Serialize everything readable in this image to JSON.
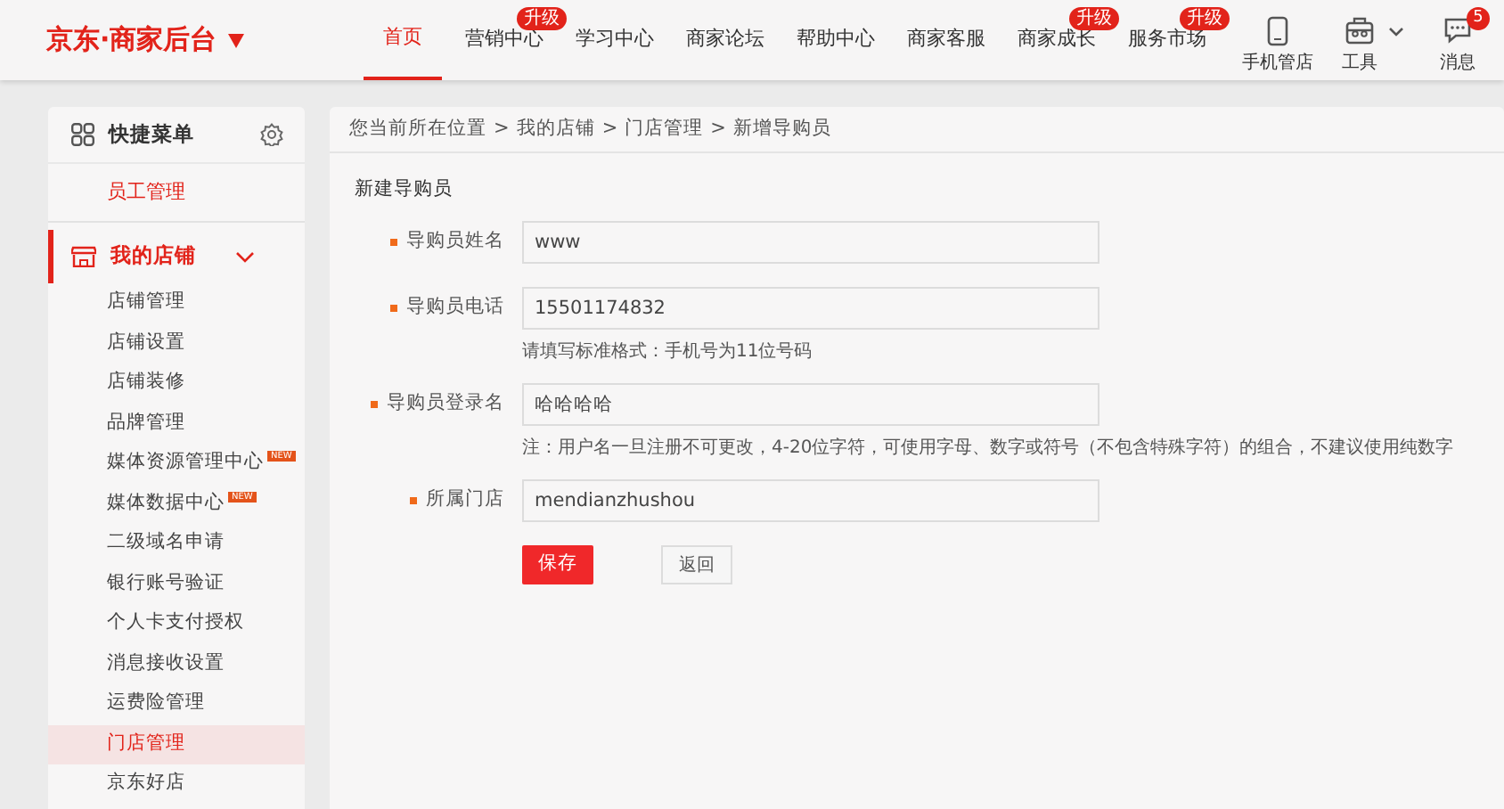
{
  "header": {
    "logo": "京东·商家后台",
    "nav": [
      {
        "label": "首页",
        "selected": true
      },
      {
        "label": "营销中心",
        "selected": false,
        "badge": "升级"
      },
      {
        "label": "学习中心",
        "selected": false
      },
      {
        "label": "商家论坛",
        "selected": false
      },
      {
        "label": "帮助中心",
        "selected": false
      },
      {
        "label": "商家客服",
        "selected": false
      },
      {
        "label": "商家成长",
        "selected": false,
        "badge": "升级"
      },
      {
        "label": "服务市场",
        "selected": false,
        "badge": "升级"
      }
    ],
    "tools": [
      {
        "kind": "phone",
        "label": "手机管店"
      },
      {
        "kind": "toolbox",
        "label": "工具",
        "has_menu": true
      },
      {
        "kind": "message",
        "label": "消息",
        "badge": "5"
      }
    ]
  },
  "sidebar": {
    "quick_menu": {
      "title": "快捷菜单",
      "items": [
        {
          "label": "员工管理"
        }
      ]
    },
    "section": {
      "title": "我的店铺",
      "expanded": true,
      "items": [
        {
          "label": "店铺管理",
          "selected": false
        },
        {
          "label": "店铺设置",
          "selected": false
        },
        {
          "label": "店铺装修",
          "selected": false
        },
        {
          "label": "品牌管理",
          "selected": false
        },
        {
          "label": "媒体资源管理中心",
          "selected": false,
          "badge": "NEW"
        },
        {
          "label": "媒体数据中心",
          "selected": false,
          "badge": "NEW"
        },
        {
          "label": "二级域名申请",
          "selected": false
        },
        {
          "label": "银行账号验证",
          "selected": false
        },
        {
          "label": "个人卡支付授权",
          "selected": false
        },
        {
          "label": "消息接收设置",
          "selected": false
        },
        {
          "label": "运费险管理",
          "selected": false
        },
        {
          "label": "门店管理",
          "selected": true
        },
        {
          "label": "京东好店",
          "selected": false
        }
      ]
    }
  },
  "main": {
    "breadcrumb": [
      "您当前所在位置",
      "我的店铺",
      "门店管理",
      "新增导购员"
    ],
    "breadcrumb_separator": ">",
    "form_title": "新建导购员",
    "fields": [
      {
        "label": "导购员姓名",
        "required": true,
        "value": "www"
      },
      {
        "label": "导购员电话",
        "required": true,
        "value": "15501174832",
        "hint": "请填写标准格式：手机号为11位号码"
      },
      {
        "label": "导购员登录名",
        "required": true,
        "value": "哈哈哈哈",
        "hint": "注：用户名一旦注册不可更改，4-20位字符，可使用字母、数字或符号（不包含特殊字符）的组合，不建议使用纯数字"
      },
      {
        "label": "所属门店",
        "required": true,
        "value": "mendianzhushou"
      }
    ],
    "buttons": [
      {
        "kind": "primary",
        "label": "保存"
      },
      {
        "kind": "secondary",
        "label": "返回"
      }
    ]
  }
}
